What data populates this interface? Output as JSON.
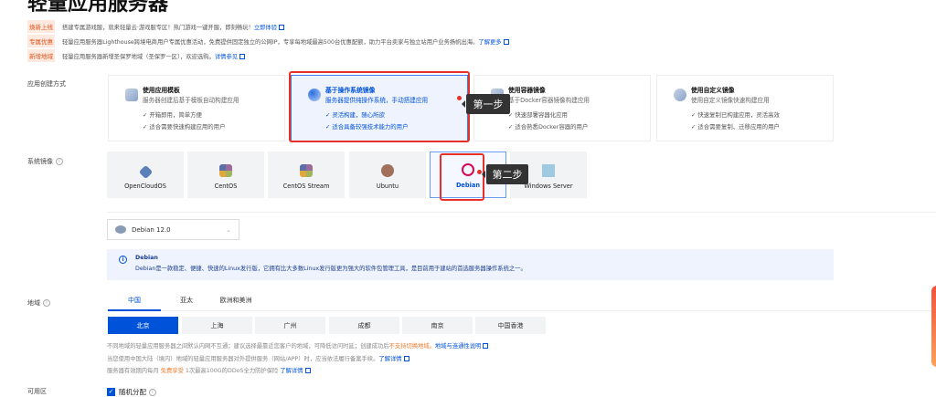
{
  "page_title": "轻量应用服务器",
  "notices": [
    {
      "badge": "焕新上线",
      "text": "搭建专属游戏服，就来轻量云·游戏服专区！热门游戏一键开服，即刻畅玩！",
      "link": "立即体验"
    },
    {
      "badge": "专属优惠",
      "text": "轻量应用服务器Lighthouse跨境电商用户专属优惠活动，免费提供固定独立的公网IP，专享每地域最高500台优惠配额，助力平台卖家与独立站用户业务扬帆出海。",
      "link": "了解更多"
    },
    {
      "badge": "新增地域",
      "text": "轻量应用服务器新增圣保罗地域（圣保罗一区），欢迎选购。",
      "link": "详情参见"
    }
  ],
  "creation": {
    "label": "应用创建方式",
    "cards": [
      {
        "title": "使用应用模板",
        "sub": "服务器创建后基于模板自动构建应用",
        "b1": "开箱即用，简单方便",
        "b2": "适合需要快速构建应用的用户"
      },
      {
        "title": "基于操作系统镜像",
        "sub": "服务器提供纯操作系统，手动搭建应用",
        "b1": "灵活构建，随心所欲",
        "b2": "适合具备较强技术能力的用户"
      },
      {
        "title": "使用容器镜像",
        "sub": "基于Docker容器镜像构建应用",
        "b1": "快速部署容器化应用",
        "b2": "适合熟悉Docker容器的用户"
      },
      {
        "title": "使用自定义镜像",
        "sub": "使用自定义镜像快速构建应用",
        "b1": "快速复制已构建应用，灵活高效",
        "b2": "适合需要复制、迁移应用的用户"
      }
    ]
  },
  "step1": "第一步",
  "step2": "第二步",
  "image": {
    "label": "系统镜像",
    "os": [
      "OpenCloudOS",
      "CentOS",
      "CentOS Stream",
      "Ubuntu",
      "Debian",
      "Windows Server"
    ],
    "version": "Debian 12.0",
    "info_title": "Debian",
    "info_text": "Debian是一款稳定、便捷、快速的Linux发行版，它拥有比大多数Linux发行版更为强大的软件包管理工具，是目前用于建站的首选服务器操作系统之一。"
  },
  "region": {
    "label": "地域",
    "tabs": [
      "中国",
      "亚太",
      "欧洲和美洲"
    ],
    "cities": [
      "北京",
      "上海",
      "广州",
      "成都",
      "南京",
      "中国香港"
    ],
    "note1": "不同地域的轻量应用服务器之间默认内网不互通；建议选择最靠近您客户的地域，可降低访问时延；创建成功后",
    "note1_warn": "不支持切换地域。",
    "note1_link": "地域与连通性说明",
    "note2": "当您使用中国大陆（境内）地域的轻量应用服务器对外提供服务（网站/APP）时，应当依法履行备案手续。",
    "note2_link": "了解详情",
    "note3a": "服务器有效期内每月",
    "note3_free": "免费享受",
    "note3b": "1次最高100G的DDoS全力防护保险",
    "note3_link": "了解详情"
  },
  "zone": {
    "label": "可用区",
    "random": "随机分配"
  },
  "colors": {
    "primary": "#0052d9",
    "highlight": "#e8302a",
    "badge_bg": "#fde9dd"
  }
}
